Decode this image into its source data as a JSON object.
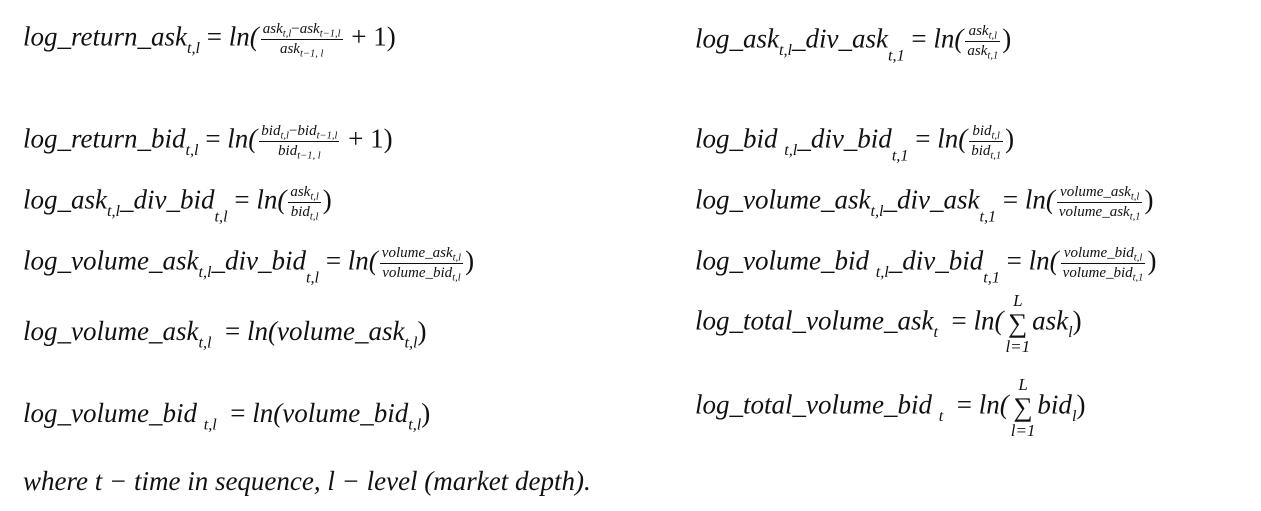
{
  "left_column": {
    "log_return_ask": {
      "lhs_name": "log_return_ask",
      "lhs_sub": "t,l",
      "rhs_ln": "ln(",
      "num_a": "ask",
      "num_a_sub": "t,l",
      "num_minus": "−",
      "num_b": "ask",
      "num_b_sub": "t−1,l",
      "den": "ask",
      "den_sub": "t−1, l",
      "tail": " + 1)"
    },
    "log_return_bid": {
      "lhs_name": "log_return_bid",
      "lhs_sub": "t,l",
      "rhs_ln": "ln(",
      "num_a": "bid",
      "num_a_sub": "t,l",
      "num_minus": "−",
      "num_b": "bid",
      "num_b_sub": "t−1,l",
      "den": "bid",
      "den_sub": "t−1, l",
      "tail": " + 1)"
    },
    "log_ask_div_bid": {
      "lhs_a": "log_ask",
      "lhs_a_sub": "t,l",
      "lhs_b": "_div_bid",
      "lhs_b_sub": "t,l",
      "rhs_ln": "ln(",
      "num": "ask",
      "num_sub": "t,l",
      "den": "bid",
      "den_sub": "t,l",
      "tail": ")"
    },
    "log_volume_ask_div_bid": {
      "lhs_a": "log_volume_ask",
      "lhs_a_sub": "t,l",
      "lhs_b": "_div_bid",
      "lhs_b_sub": "t,l",
      "rhs_ln": "ln(",
      "num": "volume_ask",
      "num_sub": "t,l",
      "den": "volume_bid",
      "den_sub": "t,l",
      "tail": ")"
    },
    "log_volume_ask": {
      "lhs_name": "log_volume_ask",
      "lhs_sub": "t,l",
      "rhs": "ln(volume_ask",
      "rhs_sub": "t,l",
      "tail": ")"
    },
    "log_volume_bid": {
      "lhs_name": "log_volume_bid ",
      "lhs_sub": "t,l",
      "rhs": "ln(volume_bid",
      "rhs_sub": "t,l",
      "tail": ")"
    }
  },
  "right_column": {
    "log_ask_div_ask": {
      "lhs_a": "log_ask",
      "lhs_a_sub": "t,l",
      "lhs_b": "_div_ask",
      "lhs_b_sub": "t,1",
      "rhs_ln": "ln(",
      "num": "ask",
      "num_sub": "t,l",
      "den": "ask",
      "den_sub": "t,1",
      "tail": ")"
    },
    "log_bid_div_bid": {
      "lhs_a": "log_bid ",
      "lhs_a_sub": "t,l",
      "lhs_b": "_div_bid",
      "lhs_b_sub": "t,1",
      "rhs_ln": "ln(",
      "num": "bid",
      "num_sub": "t,l",
      "den": "bid",
      "den_sub": "t,1",
      "tail": ")"
    },
    "log_volume_ask_div_ask": {
      "lhs_a": "log_volume_ask",
      "lhs_a_sub": "t,l",
      "lhs_b": "_div_ask",
      "lhs_b_sub": "t,1",
      "rhs_ln": "ln(",
      "num": "volume_ask",
      "num_sub": "t,l",
      "den": "volume_ask",
      "den_sub": "t,1",
      "tail": ")"
    },
    "log_volume_bid_div_bid": {
      "lhs_a": "log_volume_bid ",
      "lhs_a_sub": "t,l",
      "lhs_b": "_div_bid",
      "lhs_b_sub": "t,1",
      "rhs_ln": "ln(",
      "num": "volume_bid",
      "num_sub": "t,l",
      "den": "volume_bid",
      "den_sub": "t,1",
      "tail": ")"
    },
    "log_total_volume_ask": {
      "lhs_name": "log_total_volume_ask",
      "lhs_sub": "t",
      "rhs_ln": "ln(",
      "sum_top": "L",
      "sum_sigma": "∑",
      "sum_bot": "l=1",
      "term": "ask",
      "term_sub": "l",
      "tail": ")"
    },
    "log_total_volume_bid": {
      "lhs_name": "log_total_volume_bid ",
      "lhs_sub": "t",
      "rhs_ln": "ln(",
      "sum_top": "L",
      "sum_sigma": "∑",
      "sum_bot": "l=1",
      "term": "bid",
      "term_sub": "l",
      "tail": ")"
    }
  },
  "footnote": {
    "text": "where t  −  time in sequence,  l  −  level (market depth)."
  }
}
